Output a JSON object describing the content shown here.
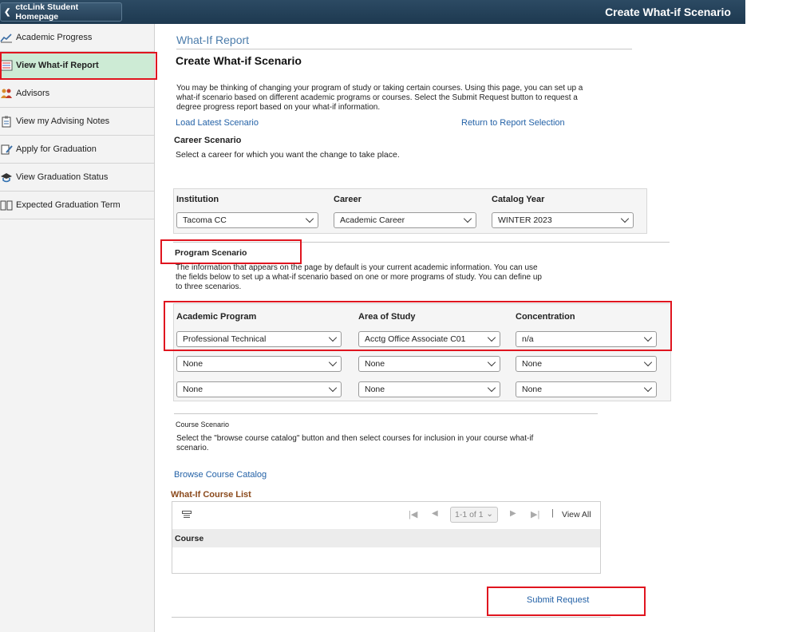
{
  "header": {
    "home_label": "ctcLink Student Homepage",
    "title": "Create What-if Scenario"
  },
  "sidebar": {
    "items": [
      {
        "label": "Academic Progress",
        "icon": "chart-line-icon"
      },
      {
        "label": "View What-if Report",
        "icon": "report-icon",
        "active": true
      },
      {
        "label": "Advisors",
        "icon": "people-icon"
      },
      {
        "label": "View my Advising Notes",
        "icon": "clipboard-icon"
      },
      {
        "label": "Apply for Graduation",
        "icon": "apply-icon"
      },
      {
        "label": "View Graduation Status",
        "icon": "grad-cap-icon"
      },
      {
        "label": "Expected Graduation Term",
        "icon": "book-icon"
      }
    ]
  },
  "main": {
    "report_heading": "What-If Report",
    "create_heading": "Create What-if Scenario",
    "intro": "You may be thinking of changing your program of study or taking certain courses. Using this page, you can set up a what-if scenario based on different academic programs or courses. Select the Submit Request button to request a degree progress report based on your what-if information.",
    "load_latest": "Load Latest Scenario",
    "return_link": "Return to Report Selection",
    "career_title": "Career Scenario",
    "career_desc": "Select a career for which you want the change to take place.",
    "career_grid": {
      "headers": [
        "Institution",
        "Career",
        "Catalog Year"
      ],
      "values": [
        "Tacoma CC",
        "Academic Career",
        "WINTER 2023"
      ]
    },
    "program_title": "Program Scenario",
    "program_desc": "The information that appears on the page by default is your current academic information. You can use the fields below to set up a what-if scenario based on one or more programs of study. You can define up to three scenarios.",
    "program_grid": {
      "headers": [
        "Academic Program",
        "Area of Study",
        "Concentration"
      ],
      "rows": [
        [
          "Professional Technical",
          "Acctg Office Associate C01",
          "n/a"
        ],
        [
          "None",
          "None",
          "None"
        ],
        [
          "None",
          "None",
          "None"
        ]
      ]
    },
    "course_title": "Course Scenario",
    "course_desc": "Select the \"browse course catalog\" button and then select courses for inclusion in your course what-if scenario.",
    "browse_link": "Browse Course Catalog",
    "course_list_title": "What-If Course List",
    "pager_text": "1-1 of 1",
    "view_all": "View All",
    "course_col": "Course",
    "submit_label": "Submit Request"
  },
  "colors": {
    "header_bg": "#1d3950",
    "active_nav": "#cdebd5",
    "highlight": "#e0151f",
    "link": "#2462a7",
    "course_list_title": "#8b4a1c"
  }
}
